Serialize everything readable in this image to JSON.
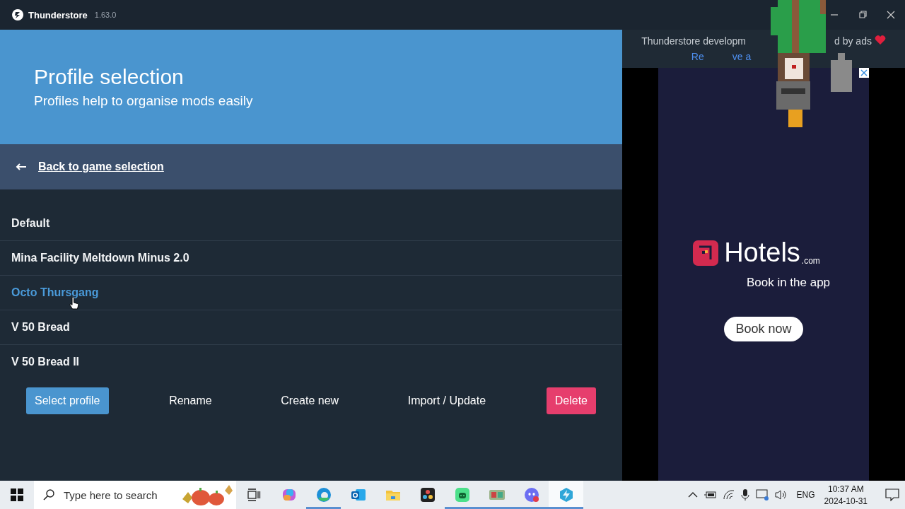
{
  "window": {
    "title": "Thunderstore",
    "version": "1.63.0"
  },
  "header": {
    "title": "Profile selection",
    "subtitle": "Profiles help to organise mods easily"
  },
  "back_link": {
    "label": "Back to game selection"
  },
  "profiles": [
    {
      "name": "Default",
      "hovered": false
    },
    {
      "name": "Mina Facility Meltdown Minus 2.0",
      "hovered": false
    },
    {
      "name": "Octo Thursgang",
      "hovered": true
    },
    {
      "name": "V 50 Bread",
      "hovered": false
    },
    {
      "name": "V 50 Bread II",
      "hovered": false
    }
  ],
  "actions": [
    {
      "label": "Select profile",
      "kind": "primary"
    },
    {
      "label": "Rename",
      "kind": "plain"
    },
    {
      "label": "Create new",
      "kind": "plain"
    },
    {
      "label": "Import / Update",
      "kind": "plain"
    },
    {
      "label": "Delete",
      "kind": "danger"
    }
  ],
  "ad_notice": {
    "text_start": "Thunderstore developm",
    "text_end": "d by ads",
    "link_start": "Re",
    "link_end": "ve a"
  },
  "ad": {
    "brand": "Hotels",
    "brand_suffix": ".com",
    "tagline": "Book in the app",
    "button": "Book now"
  },
  "taskbar": {
    "search_placeholder": "Type here to search",
    "apps": [
      {
        "kind": "copilot",
        "open": false,
        "selected": false
      },
      {
        "kind": "edge",
        "open": true,
        "selected": false
      },
      {
        "kind": "outlook",
        "open": false,
        "selected": false
      },
      {
        "kind": "files",
        "open": false,
        "selected": false
      },
      {
        "kind": "resolve",
        "open": false,
        "selected": false
      },
      {
        "kind": "robot",
        "open": true,
        "selected": false
      },
      {
        "kind": "game",
        "open": true,
        "selected": false
      },
      {
        "kind": "discord",
        "open": true,
        "selected": false
      },
      {
        "kind": "thunderstore",
        "open": true,
        "selected": true
      }
    ],
    "language": "ENG",
    "time": "10:37 AM",
    "date": "2024-10-31"
  }
}
